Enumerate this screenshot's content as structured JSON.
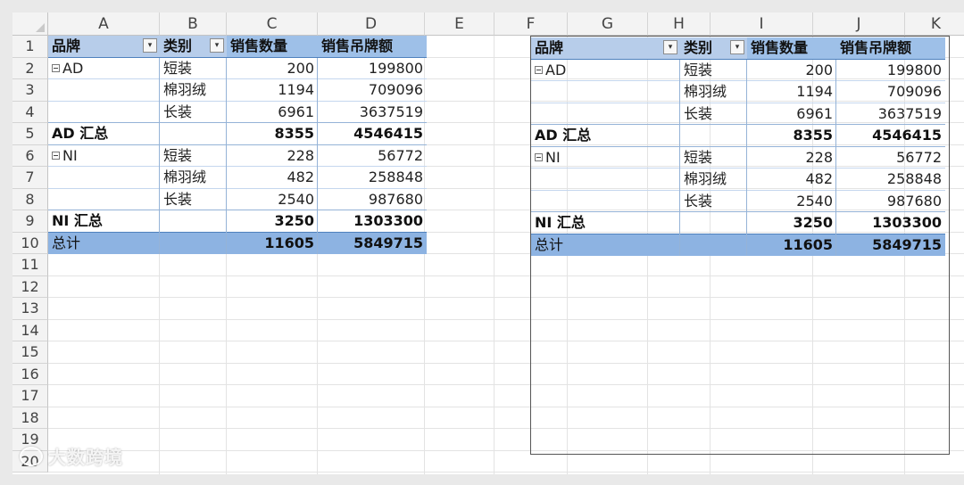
{
  "columns": [
    "A",
    "B",
    "C",
    "D",
    "E",
    "F",
    "G",
    "H",
    "I",
    "J",
    "K"
  ],
  "rows": [
    "1",
    "2",
    "3",
    "4",
    "5",
    "6",
    "7",
    "8",
    "9",
    "10",
    "11",
    "12",
    "13",
    "14",
    "15",
    "16",
    "17",
    "18",
    "19",
    "20"
  ],
  "pivot": {
    "headers": {
      "brand": "品牌",
      "category": "类别",
      "qty": "销售数量",
      "amount": "销售吊牌额"
    },
    "filter_glyph": "▾",
    "groups": [
      {
        "name": "AD",
        "items": [
          {
            "category": "短装",
            "qty": "200",
            "amount": "199800"
          },
          {
            "category": "棉羽绒",
            "qty": "1194",
            "amount": "709096"
          },
          {
            "category": "长装",
            "qty": "6961",
            "amount": "3637519"
          }
        ],
        "subtotal_label": "AD 汇总",
        "subtotal_qty": "8355",
        "subtotal_amount": "4546415"
      },
      {
        "name": "NI",
        "items": [
          {
            "category": "短装",
            "qty": "228",
            "amount": "56772"
          },
          {
            "category": "棉羽绒",
            "qty": "482",
            "amount": "258848"
          },
          {
            "category": "长装",
            "qty": "2540",
            "amount": "987680"
          }
        ],
        "subtotal_label": "NI 汇总",
        "subtotal_qty": "3250",
        "subtotal_amount": "1303300"
      }
    ],
    "grand_total": {
      "label": "总计",
      "qty": "11605",
      "amount": "5849715"
    }
  },
  "watermark": "大数跨境"
}
